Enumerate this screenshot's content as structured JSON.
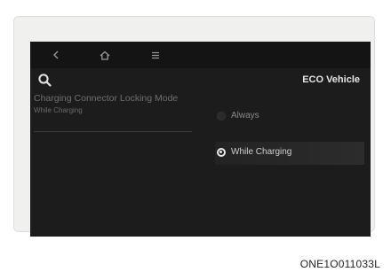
{
  "topbar": {
    "back_icon": "chevron-left-icon",
    "home_icon": "home-icon",
    "menu_icon": "menu-icon"
  },
  "left_panel": {
    "search_icon": "search-icon",
    "item": {
      "title": "Charging Connector Locking Mode",
      "subtitle": "While Charging"
    }
  },
  "right_panel": {
    "title": "ECO Vehicle",
    "options": [
      {
        "label": "Always",
        "selected": false
      },
      {
        "label": "While Charging",
        "selected": true
      }
    ]
  },
  "caption": "ONE1O011033L",
  "colors": {
    "screen_bg": "#1c1c1c",
    "frame_bg": "#f0f0ee",
    "selected_radio": "#e8e8e8"
  }
}
